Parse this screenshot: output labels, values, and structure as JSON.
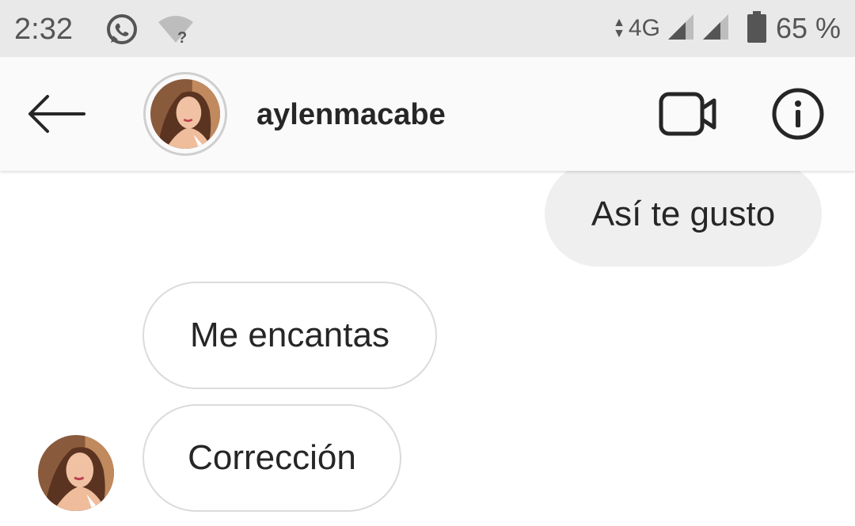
{
  "status_bar": {
    "time": "2:32",
    "network_type": "4G",
    "battery_percent": "65 %",
    "icons": [
      "whatsapp-icon",
      "wifi-question-icon",
      "data-arrows-icon",
      "signal-icon",
      "signal-icon",
      "battery-icon"
    ]
  },
  "header": {
    "username": "aylenmacabe",
    "icons": [
      "back-arrow-icon",
      "video-call-icon",
      "info-icon"
    ]
  },
  "messages": [
    {
      "direction": "sent",
      "text": "Así te gusto"
    },
    {
      "direction": "received",
      "text": "Me encantas"
    },
    {
      "direction": "received",
      "text": "Corrección"
    }
  ],
  "colors": {
    "status_bar_bg": "#e9e9e9",
    "header_bg": "#fafafa",
    "sent_bubble_bg": "#efefef",
    "received_bubble_border": "#dbdbdb",
    "text": "#262626"
  }
}
